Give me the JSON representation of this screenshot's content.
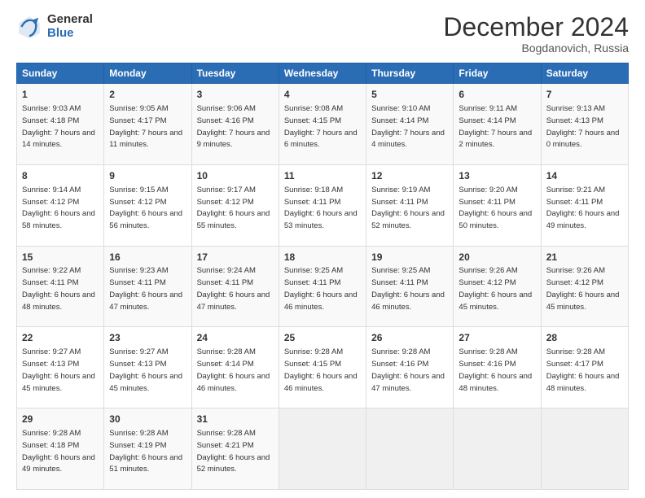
{
  "logo": {
    "general": "General",
    "blue": "Blue"
  },
  "header": {
    "month": "December 2024",
    "location": "Bogdanovich, Russia"
  },
  "weekdays": [
    "Sunday",
    "Monday",
    "Tuesday",
    "Wednesday",
    "Thursday",
    "Friday",
    "Saturday"
  ],
  "weeks": [
    [
      {
        "day": "1",
        "sunrise": "Sunrise: 9:03 AM",
        "sunset": "Sunset: 4:18 PM",
        "daylight": "Daylight: 7 hours and 14 minutes."
      },
      {
        "day": "2",
        "sunrise": "Sunrise: 9:05 AM",
        "sunset": "Sunset: 4:17 PM",
        "daylight": "Daylight: 7 hours and 11 minutes."
      },
      {
        "day": "3",
        "sunrise": "Sunrise: 9:06 AM",
        "sunset": "Sunset: 4:16 PM",
        "daylight": "Daylight: 7 hours and 9 minutes."
      },
      {
        "day": "4",
        "sunrise": "Sunrise: 9:08 AM",
        "sunset": "Sunset: 4:15 PM",
        "daylight": "Daylight: 7 hours and 6 minutes."
      },
      {
        "day": "5",
        "sunrise": "Sunrise: 9:10 AM",
        "sunset": "Sunset: 4:14 PM",
        "daylight": "Daylight: 7 hours and 4 minutes."
      },
      {
        "day": "6",
        "sunrise": "Sunrise: 9:11 AM",
        "sunset": "Sunset: 4:14 PM",
        "daylight": "Daylight: 7 hours and 2 minutes."
      },
      {
        "day": "7",
        "sunrise": "Sunrise: 9:13 AM",
        "sunset": "Sunset: 4:13 PM",
        "daylight": "Daylight: 7 hours and 0 minutes."
      }
    ],
    [
      {
        "day": "8",
        "sunrise": "Sunrise: 9:14 AM",
        "sunset": "Sunset: 4:12 PM",
        "daylight": "Daylight: 6 hours and 58 minutes."
      },
      {
        "day": "9",
        "sunrise": "Sunrise: 9:15 AM",
        "sunset": "Sunset: 4:12 PM",
        "daylight": "Daylight: 6 hours and 56 minutes."
      },
      {
        "day": "10",
        "sunrise": "Sunrise: 9:17 AM",
        "sunset": "Sunset: 4:12 PM",
        "daylight": "Daylight: 6 hours and 55 minutes."
      },
      {
        "day": "11",
        "sunrise": "Sunrise: 9:18 AM",
        "sunset": "Sunset: 4:11 PM",
        "daylight": "Daylight: 6 hours and 53 minutes."
      },
      {
        "day": "12",
        "sunrise": "Sunrise: 9:19 AM",
        "sunset": "Sunset: 4:11 PM",
        "daylight": "Daylight: 6 hours and 52 minutes."
      },
      {
        "day": "13",
        "sunrise": "Sunrise: 9:20 AM",
        "sunset": "Sunset: 4:11 PM",
        "daylight": "Daylight: 6 hours and 50 minutes."
      },
      {
        "day": "14",
        "sunrise": "Sunrise: 9:21 AM",
        "sunset": "Sunset: 4:11 PM",
        "daylight": "Daylight: 6 hours and 49 minutes."
      }
    ],
    [
      {
        "day": "15",
        "sunrise": "Sunrise: 9:22 AM",
        "sunset": "Sunset: 4:11 PM",
        "daylight": "Daylight: 6 hours and 48 minutes."
      },
      {
        "day": "16",
        "sunrise": "Sunrise: 9:23 AM",
        "sunset": "Sunset: 4:11 PM",
        "daylight": "Daylight: 6 hours and 47 minutes."
      },
      {
        "day": "17",
        "sunrise": "Sunrise: 9:24 AM",
        "sunset": "Sunset: 4:11 PM",
        "daylight": "Daylight: 6 hours and 47 minutes."
      },
      {
        "day": "18",
        "sunrise": "Sunrise: 9:25 AM",
        "sunset": "Sunset: 4:11 PM",
        "daylight": "Daylight: 6 hours and 46 minutes."
      },
      {
        "day": "19",
        "sunrise": "Sunrise: 9:25 AM",
        "sunset": "Sunset: 4:11 PM",
        "daylight": "Daylight: 6 hours and 46 minutes."
      },
      {
        "day": "20",
        "sunrise": "Sunrise: 9:26 AM",
        "sunset": "Sunset: 4:12 PM",
        "daylight": "Daylight: 6 hours and 45 minutes."
      },
      {
        "day": "21",
        "sunrise": "Sunrise: 9:26 AM",
        "sunset": "Sunset: 4:12 PM",
        "daylight": "Daylight: 6 hours and 45 minutes."
      }
    ],
    [
      {
        "day": "22",
        "sunrise": "Sunrise: 9:27 AM",
        "sunset": "Sunset: 4:13 PM",
        "daylight": "Daylight: 6 hours and 45 minutes."
      },
      {
        "day": "23",
        "sunrise": "Sunrise: 9:27 AM",
        "sunset": "Sunset: 4:13 PM",
        "daylight": "Daylight: 6 hours and 45 minutes."
      },
      {
        "day": "24",
        "sunrise": "Sunrise: 9:28 AM",
        "sunset": "Sunset: 4:14 PM",
        "daylight": "Daylight: 6 hours and 46 minutes."
      },
      {
        "day": "25",
        "sunrise": "Sunrise: 9:28 AM",
        "sunset": "Sunset: 4:15 PM",
        "daylight": "Daylight: 6 hours and 46 minutes."
      },
      {
        "day": "26",
        "sunrise": "Sunrise: 9:28 AM",
        "sunset": "Sunset: 4:16 PM",
        "daylight": "Daylight: 6 hours and 47 minutes."
      },
      {
        "day": "27",
        "sunrise": "Sunrise: 9:28 AM",
        "sunset": "Sunset: 4:16 PM",
        "daylight": "Daylight: 6 hours and 48 minutes."
      },
      {
        "day": "28",
        "sunrise": "Sunrise: 9:28 AM",
        "sunset": "Sunset: 4:17 PM",
        "daylight": "Daylight: 6 hours and 48 minutes."
      }
    ],
    [
      {
        "day": "29",
        "sunrise": "Sunrise: 9:28 AM",
        "sunset": "Sunset: 4:18 PM",
        "daylight": "Daylight: 6 hours and 49 minutes."
      },
      {
        "day": "30",
        "sunrise": "Sunrise: 9:28 AM",
        "sunset": "Sunset: 4:19 PM",
        "daylight": "Daylight: 6 hours and 51 minutes."
      },
      {
        "day": "31",
        "sunrise": "Sunrise: 9:28 AM",
        "sunset": "Sunset: 4:21 PM",
        "daylight": "Daylight: 6 hours and 52 minutes."
      },
      null,
      null,
      null,
      null
    ]
  ]
}
